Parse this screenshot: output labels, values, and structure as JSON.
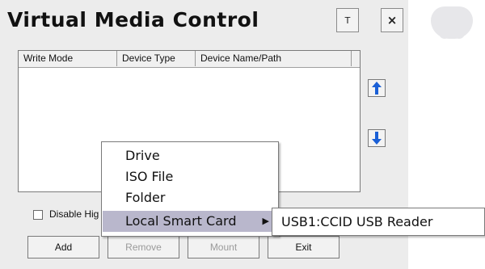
{
  "window": {
    "title": "Virtual Media Control",
    "pin_button": "T",
    "close_button": "×"
  },
  "device_list": {
    "columns": [
      "Write Mode",
      "Device Type",
      "Device Name/Path"
    ],
    "rows": []
  },
  "checkbox": {
    "label": "Disable Hig",
    "checked": false
  },
  "buttons": {
    "add": "Add",
    "remove": "Remove",
    "mount": "Mount",
    "exit": "Exit"
  },
  "context_menu": {
    "items": [
      "Drive",
      "ISO File",
      "Folder",
      "Local Smart Card"
    ],
    "highlighted": "Local Smart Card",
    "submenu_arrow": "▶",
    "submenu": {
      "items": [
        "USB1:CCID USB Reader"
      ]
    }
  },
  "colors": {
    "dialog_bg": "#ececec",
    "arrow_blue": "#1a5fd6",
    "menu_highlight": "#b9b7cc"
  }
}
